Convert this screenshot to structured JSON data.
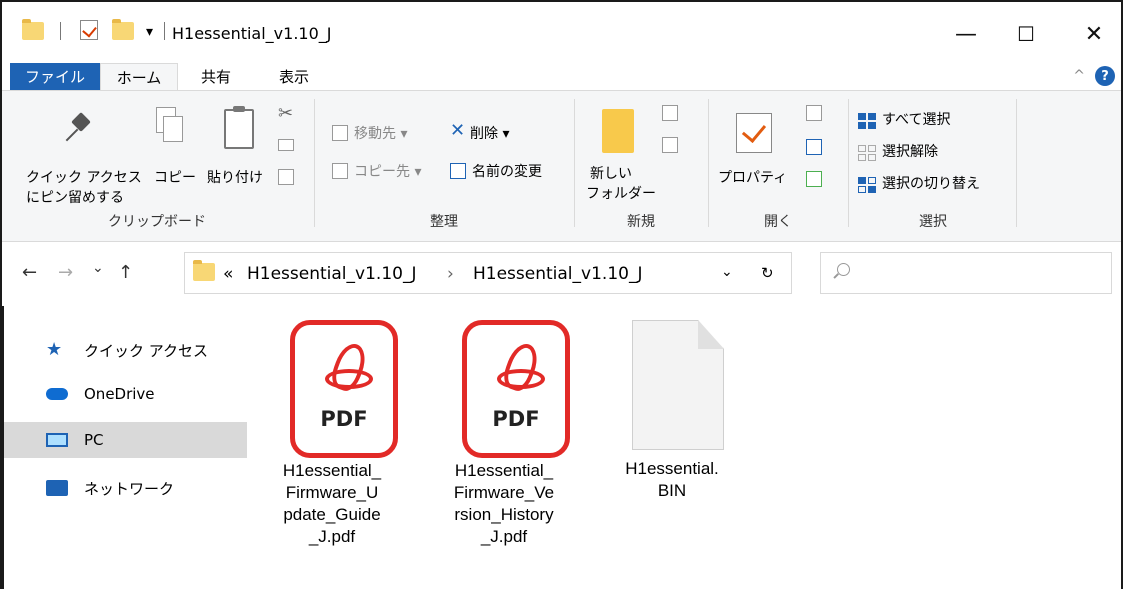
{
  "window": {
    "title": "H1essential_v1.10_J",
    "quick_access_dropdown": "▾",
    "minimize": "—",
    "maximize": "☐",
    "close": "✕"
  },
  "tabs": {
    "file": "ファイル",
    "home": "ホーム",
    "share": "共有",
    "view": "表示",
    "collapse": "^",
    "help": "?"
  },
  "ribbon": {
    "clipboard": {
      "label": "クリップボード",
      "pin_line1": "クイック アクセス",
      "pin_line2": "にピン留めする",
      "copy": "コピー",
      "paste": "貼り付け"
    },
    "organize": {
      "label": "整理",
      "move_to": "移動先",
      "delete": "削除",
      "copy_to": "コピー先",
      "rename": "名前の変更"
    },
    "new": {
      "label": "新規",
      "new_folder_line1": "新しい",
      "new_folder_line2": "フォルダー"
    },
    "open": {
      "label": "開く",
      "properties": "プロパティ"
    },
    "select": {
      "label": "選択",
      "select_all": "すべて選択",
      "select_none": "選択解除",
      "invert": "選択の切り替え"
    }
  },
  "address": {
    "back": "←",
    "forward": "→",
    "recent": "⌄",
    "up": "↑",
    "overflow": "«",
    "path": [
      "H1essential_v1.10_J",
      "H1essential_v1.10_J"
    ],
    "separator": "›",
    "dropdown": "⌄",
    "refresh": "↻"
  },
  "nav_pane": {
    "items": [
      {
        "label": "クイック アクセス",
        "icon": "star-icon"
      },
      {
        "label": "OneDrive",
        "icon": "cloud-icon"
      },
      {
        "label": "PC",
        "icon": "monitor-icon",
        "selected": true
      },
      {
        "label": "ネットワーク",
        "icon": "network-icon"
      }
    ]
  },
  "files": [
    {
      "name": "H1essential_\nFirmware_U\npdate_Guide\n_J.pdf",
      "type": "pdf",
      "badge": "PDF"
    },
    {
      "name": "H1essential_\nFirmware_Ve\nrsion_History\n_J.pdf",
      "type": "pdf",
      "badge": "PDF"
    },
    {
      "name": "H1essential.\nBIN",
      "type": "bin"
    }
  ]
}
